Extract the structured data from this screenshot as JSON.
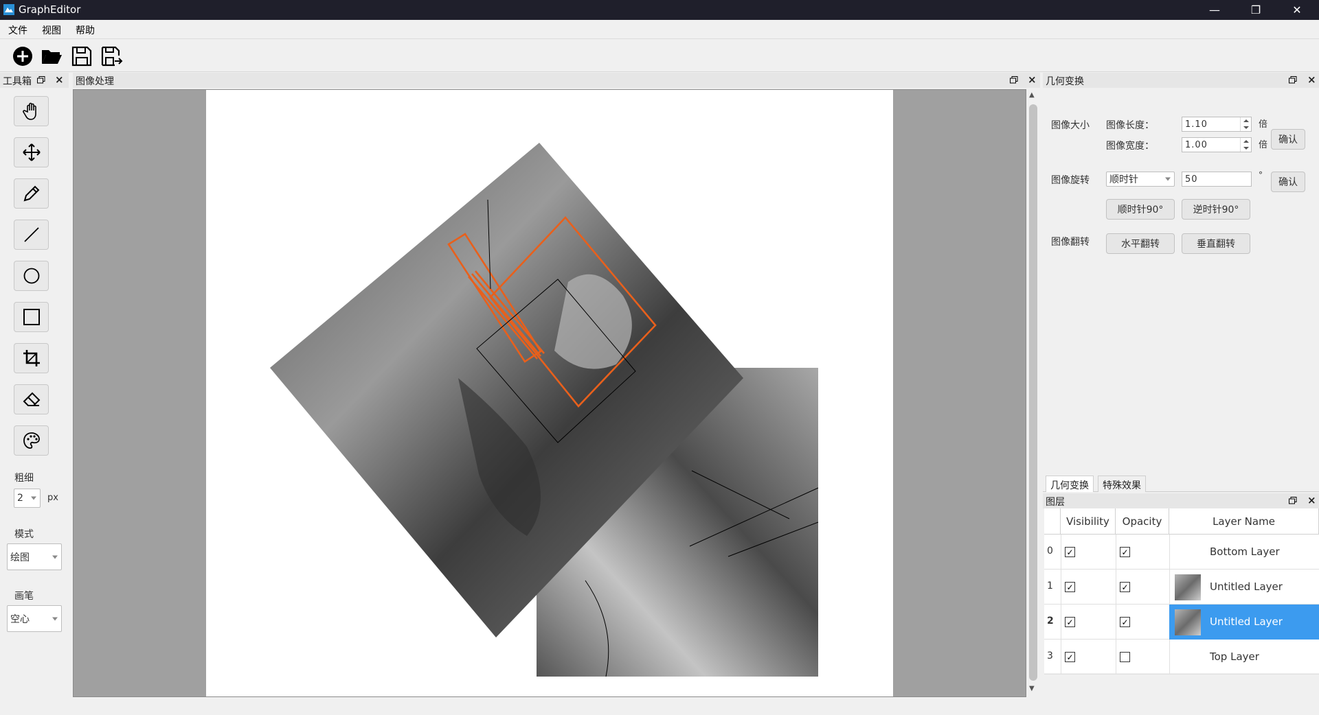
{
  "window": {
    "title": "GraphEditor",
    "minimize": "—",
    "maximize": "❐",
    "close": "✕"
  },
  "menu": [
    "文件",
    "视图",
    "帮助"
  ],
  "toolbar": {
    "new_icon": "plus-circle-icon",
    "open_icon": "folder-open-icon",
    "save_icon": "save-icon",
    "save_as_icon": "save-as-icon"
  },
  "toolbox": {
    "title": "工具箱",
    "tools": [
      "hand-icon",
      "move-icon",
      "pen-icon",
      "line-icon",
      "circle-icon",
      "rectangle-icon",
      "crop-icon",
      "eraser-icon",
      "palette-icon"
    ],
    "thickness_label": "粗细",
    "thickness_value": "2",
    "thickness_unit": "px",
    "mode_label": "模式",
    "mode_value": "绘图",
    "brush_label": "画笔",
    "brush_value": "空心"
  },
  "canvas": {
    "title": "图像处理"
  },
  "geometry": {
    "title": "几何变换",
    "size_label": "图像大小",
    "length_label": "图像长度：",
    "length_value": "1.10",
    "width_label": "图像宽度：",
    "width_value": "1.00",
    "times_unit": "倍",
    "confirm": "确认",
    "rotate_label": "图像旋转",
    "rotate_dir": "顺时针",
    "rotate_value": "50",
    "degree": "°",
    "cw90": "顺时针90°",
    "ccw90": "逆时针90°",
    "flip_label": "图像翻转",
    "flip_h": "水平翻转",
    "flip_v": "垂直翻转"
  },
  "tabs": [
    "几何变换",
    "特殊效果"
  ],
  "layers": {
    "title": "图层",
    "headers": [
      "Visibility",
      "Opacity",
      "Layer Name"
    ],
    "rows": [
      {
        "index": "0",
        "visible": true,
        "opacity": true,
        "name": "Bottom Layer",
        "thumb": false
      },
      {
        "index": "1",
        "visible": true,
        "opacity": true,
        "name": "Untitled Layer",
        "thumb": true
      },
      {
        "index": "2",
        "visible": true,
        "opacity": true,
        "name": "Untitled Layer",
        "thumb": true,
        "selected": true
      },
      {
        "index": "3",
        "visible": true,
        "opacity": false,
        "name": "Top Layer",
        "thumb": false
      }
    ]
  },
  "colors": {
    "accent": "#3c9bef",
    "stroke": "#e8601c",
    "titlebar": "#1f1f2b"
  }
}
